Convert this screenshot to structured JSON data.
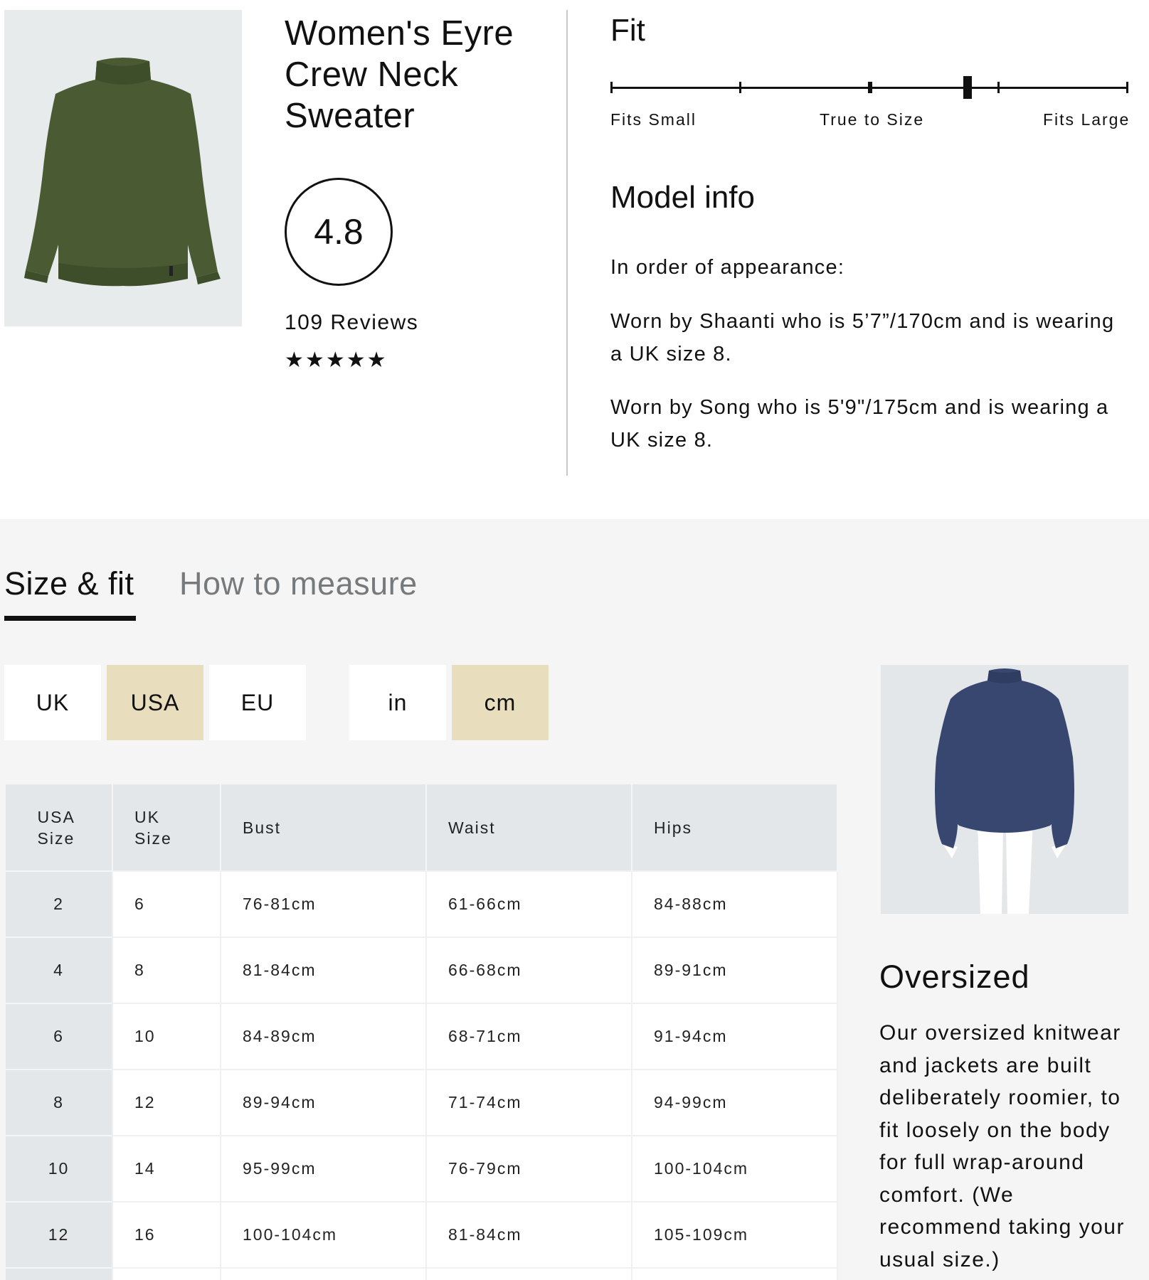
{
  "product": {
    "title": "Women's Eyre Crew Neck Sweater",
    "rating": "4.8",
    "reviews_label": "109 Reviews",
    "stars": [
      "★",
      "★",
      "★",
      "★",
      "★"
    ],
    "image_icon": "green-sweater-icon"
  },
  "fit": {
    "heading": "Fit",
    "labels": {
      "small": "Fits Small",
      "true": "True to Size",
      "large": "Fits Large"
    },
    "scale_value_fraction": 0.69
  },
  "model_info": {
    "heading": "Model info",
    "intro": "In order of appearance:",
    "models": [
      "Worn by Shaanti who is 5’7”/170cm and is wearing a UK size 8.",
      "Worn by Song who is 5'9\"/175cm and is wearing a UK size 8."
    ]
  },
  "tabs": {
    "active": "Size & fit",
    "inactive": "How to measure"
  },
  "region_toggle": {
    "options": [
      "UK",
      "USA",
      "EU"
    ],
    "selected": "USA"
  },
  "unit_toggle": {
    "options": [
      "in",
      "cm"
    ],
    "selected": "cm"
  },
  "size_table": {
    "headers": [
      "USA Size",
      "UK Size",
      "Bust",
      "Waist",
      "Hips"
    ],
    "rows": [
      [
        "2",
        "6",
        "76-81cm",
        "61-66cm",
        "84-88cm"
      ],
      [
        "4",
        "8",
        "81-84cm",
        "66-68cm",
        "89-91cm"
      ],
      [
        "6",
        "10",
        "84-89cm",
        "68-71cm",
        "91-94cm"
      ],
      [
        "8",
        "12",
        "89-94cm",
        "71-74cm",
        "94-99cm"
      ],
      [
        "10",
        "14",
        "95-99cm",
        "76-79cm",
        "100-104cm"
      ],
      [
        "12",
        "16",
        "100-104cm",
        "81-84cm",
        "105-109cm"
      ]
    ]
  },
  "fit_type": {
    "heading": "Oversized",
    "description": "Our oversized knitwear and jackets are built deliberately roomier, to fit loosely on the body for full wrap-around comfort. (We recommend taking your usual size.)",
    "image_icon": "oversized-fit-figure-icon"
  },
  "colors": {
    "selected_toggle": "#e8ddbc",
    "sweater_green": "#4a5a33",
    "figure_navy": "#38476f",
    "table_header": "#e4e7ea"
  }
}
